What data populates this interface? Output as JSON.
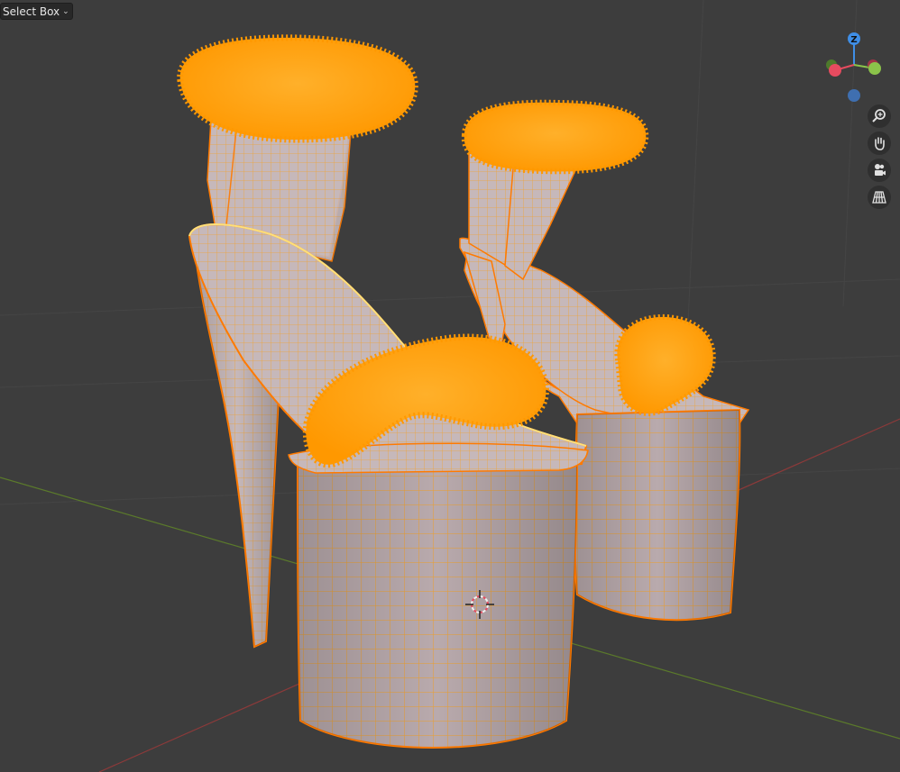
{
  "toolbar": {
    "select_tool_label": "Select Box",
    "select_tool_icon": "chevron-down-icon"
  },
  "gizmo": {
    "z_label": "Z",
    "x_color": "#e64b5f",
    "y_color": "#8bc34a",
    "z_color": "#3f8ee6"
  },
  "nav_buttons": [
    "zoom-icon",
    "hand-pan-icon",
    "camera-icon",
    "grid-ortho-icon"
  ],
  "colors": {
    "background": "#3d3d3d",
    "selection": "#ff9a00",
    "mesh_body": "#b3a3a6",
    "x_axis": "#9a3b3b",
    "y_axis": "#5b7a2b"
  }
}
